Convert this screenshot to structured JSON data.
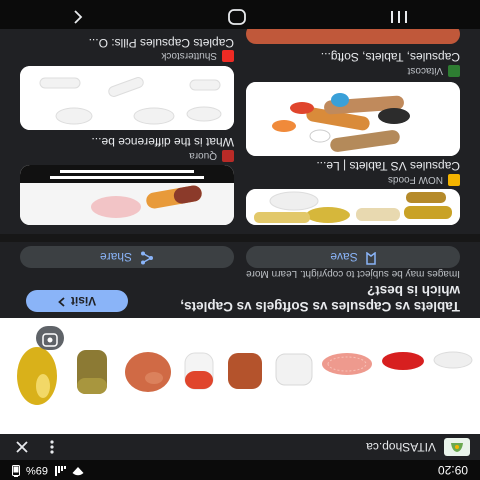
{
  "status_bar": {
    "time": "09:20",
    "battery": "69%"
  },
  "header": {
    "site_name": "VITAShop.ca",
    "more_icon": "more-vert-icon",
    "close_icon": "close-icon"
  },
  "main": {
    "title": "Tablets vs Capsules vs Softgels vs Caplets, which is best?",
    "visit_label": "Visit",
    "copyright_note": "Images may be subject to copyright. Learn More",
    "share_label": "Share",
    "save_label": "Save"
  },
  "related": [
    {
      "source": "NOW Foods",
      "title": "Capsules VS Tablets | Le..."
    },
    {
      "source": "Quora",
      "title": "What is the difference be..."
    },
    {
      "source": "Vitacost",
      "title": "Capsules, Tablets, Softg..."
    },
    {
      "source": "Shutterstock",
      "title": "Caplets Capsules Pills: O..."
    }
  ],
  "colors": {
    "accent": "#8ab4f8",
    "background": "#202124"
  }
}
